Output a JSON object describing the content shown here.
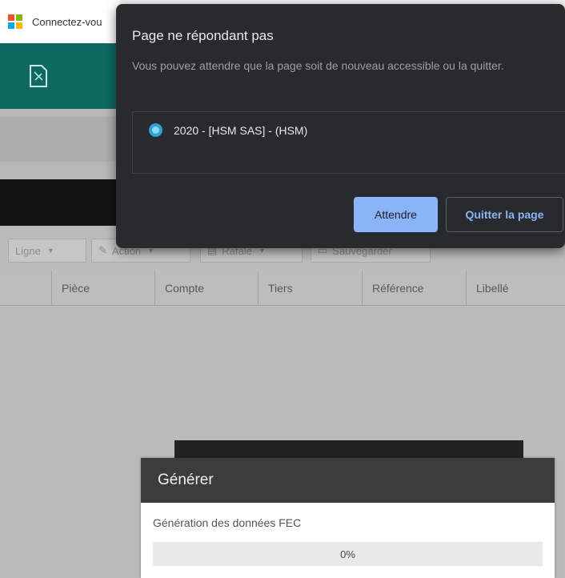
{
  "browser": {
    "tab_title": "Connectez-vou"
  },
  "unresponsive_dialog": {
    "title": "Page ne répondant pas",
    "description": "Vous pouvez attendre que la page soit de nouveau accessible ou la quitter.",
    "page_item": "2020 - [HSM SAS] - (HSM)",
    "wait_label": "Attendre",
    "quit_label": "Quitter la page",
    "accent_color": "#8ab4f8"
  },
  "toolbar": {
    "buttons": [
      "Ligne",
      "Action",
      "Rafale",
      "Sauvegarder"
    ]
  },
  "table": {
    "columns": [
      "Pièce",
      "Compte",
      "Tiers",
      "Référence",
      "Libellé"
    ]
  },
  "generate_dialog": {
    "title": "Générer",
    "label": "Génération des données FEC",
    "progress_text": "0%",
    "progress_fraction": 0
  },
  "colors": {
    "app_header": "#0e6a61",
    "dialog_bg": "#292a2d"
  },
  "icons": {
    "tab_favicon": "microsoft-logo-icon",
    "app_icon": "document-icon",
    "page_item_icon": "site-globe-icon"
  }
}
